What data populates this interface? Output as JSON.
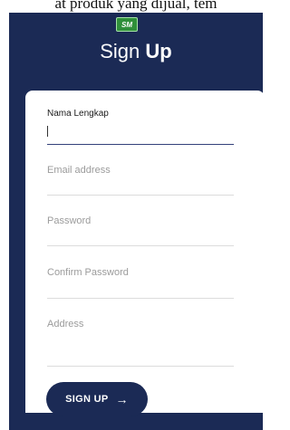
{
  "caption": "at produk yang dijual, tem",
  "logo": {
    "text": "SM"
  },
  "header": {
    "title_light": "Sign ",
    "title_bold": "Up"
  },
  "form": {
    "full_name": {
      "label": "Nama Lengkap",
      "value": ""
    },
    "email": {
      "placeholder": "Email address"
    },
    "password": {
      "placeholder": "Password"
    },
    "confirm_password": {
      "placeholder": "Confirm Password"
    },
    "address": {
      "placeholder": "Address"
    }
  },
  "signup_button": {
    "label": "SIGN UP",
    "icon": "arrow-right-icon"
  },
  "colors": {
    "navy": "#1b2a55",
    "logo_green": "#2f8f3a"
  }
}
